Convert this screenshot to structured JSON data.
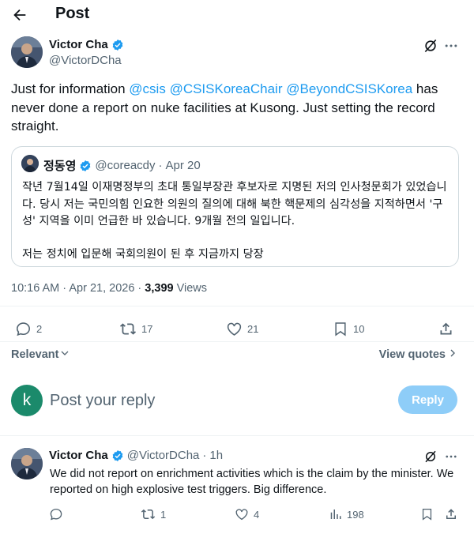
{
  "header": {
    "title": "Post"
  },
  "post": {
    "author_name": "Victor Cha",
    "author_handle": "@VictorDCha",
    "text_intro": "Just for information ",
    "mentions": [
      "@csis",
      "@CSISKoreaChair",
      "@BeyondCSISKorea"
    ],
    "text_rest": " has never done a report on nuke facilities at Kusong. Just setting the record straight.",
    "quoted": {
      "author_name": "정동영",
      "author_handle": "@coreacdy",
      "date": "Apr 20",
      "paragraph_1": "작년 7월14일 이재명정부의 초대 통일부장관 후보자로 지명된 저의 인사청문회가 있었습니다. 당시 저는 국민의힘 인요한 의원의 질의에 대해 북한 핵문제의 심각성을 지적하면서 '구성' 지역을 이미 언급한 바 있습니다. 9개월 전의 일입니다.",
      "paragraph_2": "저는 정치에 입문해 국회의원이 된 후 지금까지 당장"
    },
    "timestamp": "10:16 AM · Apr 21, 2026 · ",
    "views_count": "3,399",
    "views_label": " Views",
    "stats": {
      "replies": "2",
      "reposts": "17",
      "likes": "21",
      "bookmarks": "10"
    }
  },
  "sort": {
    "label": "Relevant",
    "view_quotes": "View quotes"
  },
  "composer": {
    "avatar_letter": "k",
    "placeholder": "Post your reply",
    "button_label": "Reply"
  },
  "reply": {
    "author_name": "Victor Cha",
    "author_handle": "@VictorDCha",
    "separator": "·",
    "time": "1h",
    "text": "We did not report on enrichment activities which is the claim by the minister. We reported on high explosive test triggers. Big difference.",
    "stats": {
      "replies": "",
      "reposts": "1",
      "likes": "4",
      "views": "198"
    }
  },
  "colors": {
    "accent": "#1d9bf0",
    "muted": "#536471",
    "reply_button": "#8ecdf8",
    "composer_avatar": "#1b8a6b"
  },
  "icons": [
    "back-arrow-icon",
    "verified-icon",
    "grok-icon",
    "more-icon",
    "reply-icon",
    "repost-icon",
    "like-icon",
    "bookmark-icon",
    "share-icon",
    "views-icon",
    "chevron-down-icon",
    "chevron-right-icon"
  ]
}
